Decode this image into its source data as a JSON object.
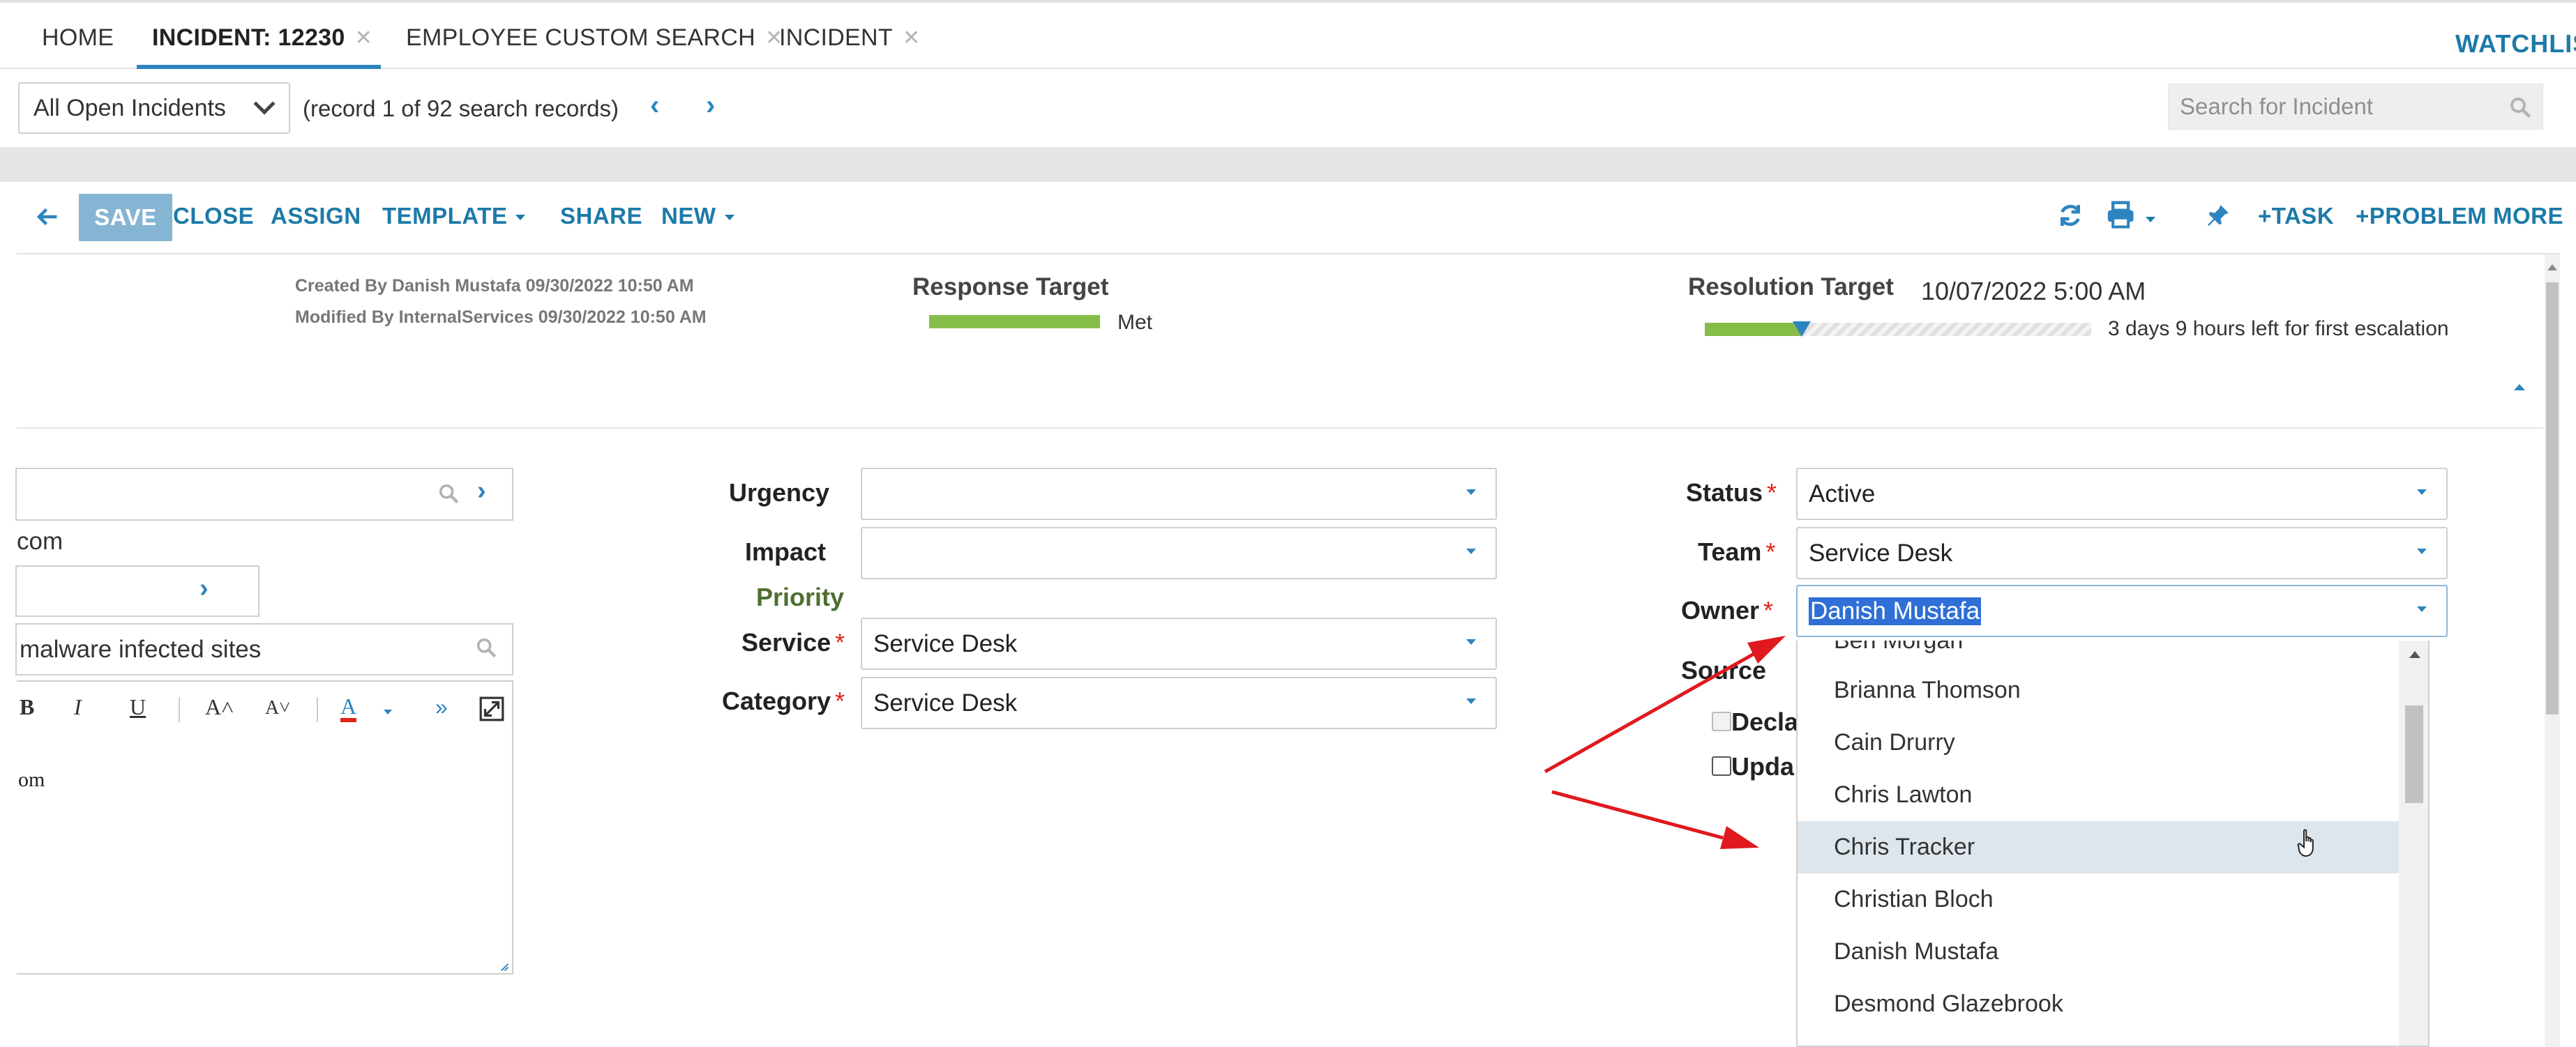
{
  "tabs": [
    {
      "label": "HOME",
      "closable": false,
      "active": false
    },
    {
      "label": "INCIDENT: 12230",
      "closable": true,
      "active": true
    },
    {
      "label": "EMPLOYEE CUSTOM SEARCH",
      "closable": true,
      "active": false
    },
    {
      "label": "INCIDENT",
      "closable": true,
      "active": false
    }
  ],
  "tab_close_glyph": "✕",
  "watchlist_label": "WATCHLIS",
  "recordbar": {
    "view_select": "All Open Incidents",
    "record_count": "(record 1 of 92 search records)",
    "prev_glyph": "‹",
    "next_glyph": "›",
    "search_placeholder": "Search for Incident"
  },
  "toolbar": {
    "back_icon": "back-arrow-icon",
    "save": "SAVE",
    "close": "CLOSE",
    "assign": "ASSIGN",
    "template": "TEMPLATE",
    "share": "SHARE",
    "new": "NEW",
    "task": "+TASK",
    "problem": "+PROBLEM",
    "more": "MORE"
  },
  "header": {
    "created": "Created By Danish Mustafa 09/30/2022 10:50 AM",
    "modified": "Modified By InternalServices 09/30/2022 10:50 AM",
    "response_target_label": "Response Target",
    "response_status": "Met",
    "resolution_target_label": "Resolution Target",
    "resolution_date": "10/07/2022 5:00 AM",
    "resolution_remaining": "3 days 9 hours left for first escalation",
    "resolution_progress": 0.25
  },
  "left_column": {
    "email_fragment": "com",
    "summary_fragment": "malware infected sites",
    "editor_body_fragment": "om",
    "editor_tools": [
      "B",
      "I",
      "U",
      "A˄",
      "A˅",
      "A",
      "»"
    ]
  },
  "form": {
    "urgency": {
      "label": "Urgency",
      "value": ""
    },
    "impact": {
      "label": "Impact",
      "value": ""
    },
    "priority_label": "Priority",
    "service": {
      "label": "Service",
      "value": "Service Desk"
    },
    "category": {
      "label": "Category",
      "value": "Service Desk"
    },
    "status": {
      "label": "Status",
      "value": "Active"
    },
    "team": {
      "label": "Team",
      "value": "Service Desk"
    },
    "owner": {
      "label": "Owner",
      "value": "Danish Mustafa"
    },
    "source_label": "Source",
    "declared_fragment": "Decla",
    "update_fragment": "Upda",
    "required_mark": "*"
  },
  "owner_dropdown": {
    "items": [
      "Ben Morgan",
      "Brianna Thomson",
      "Cain Drurry",
      "Chris Lawton",
      "Chris Tracker",
      "Christian Bloch",
      "Danish Mustafa",
      "Desmond Glazebrook"
    ],
    "hovered": "Chris Tracker"
  },
  "colors": {
    "accent": "#1d7aa8",
    "save_bg": "#86b5d3",
    "progress_green": "#86bd49",
    "required_red": "#e2231a",
    "annotation_red": "#e0191e",
    "selection_blue": "#2f6fd6"
  }
}
